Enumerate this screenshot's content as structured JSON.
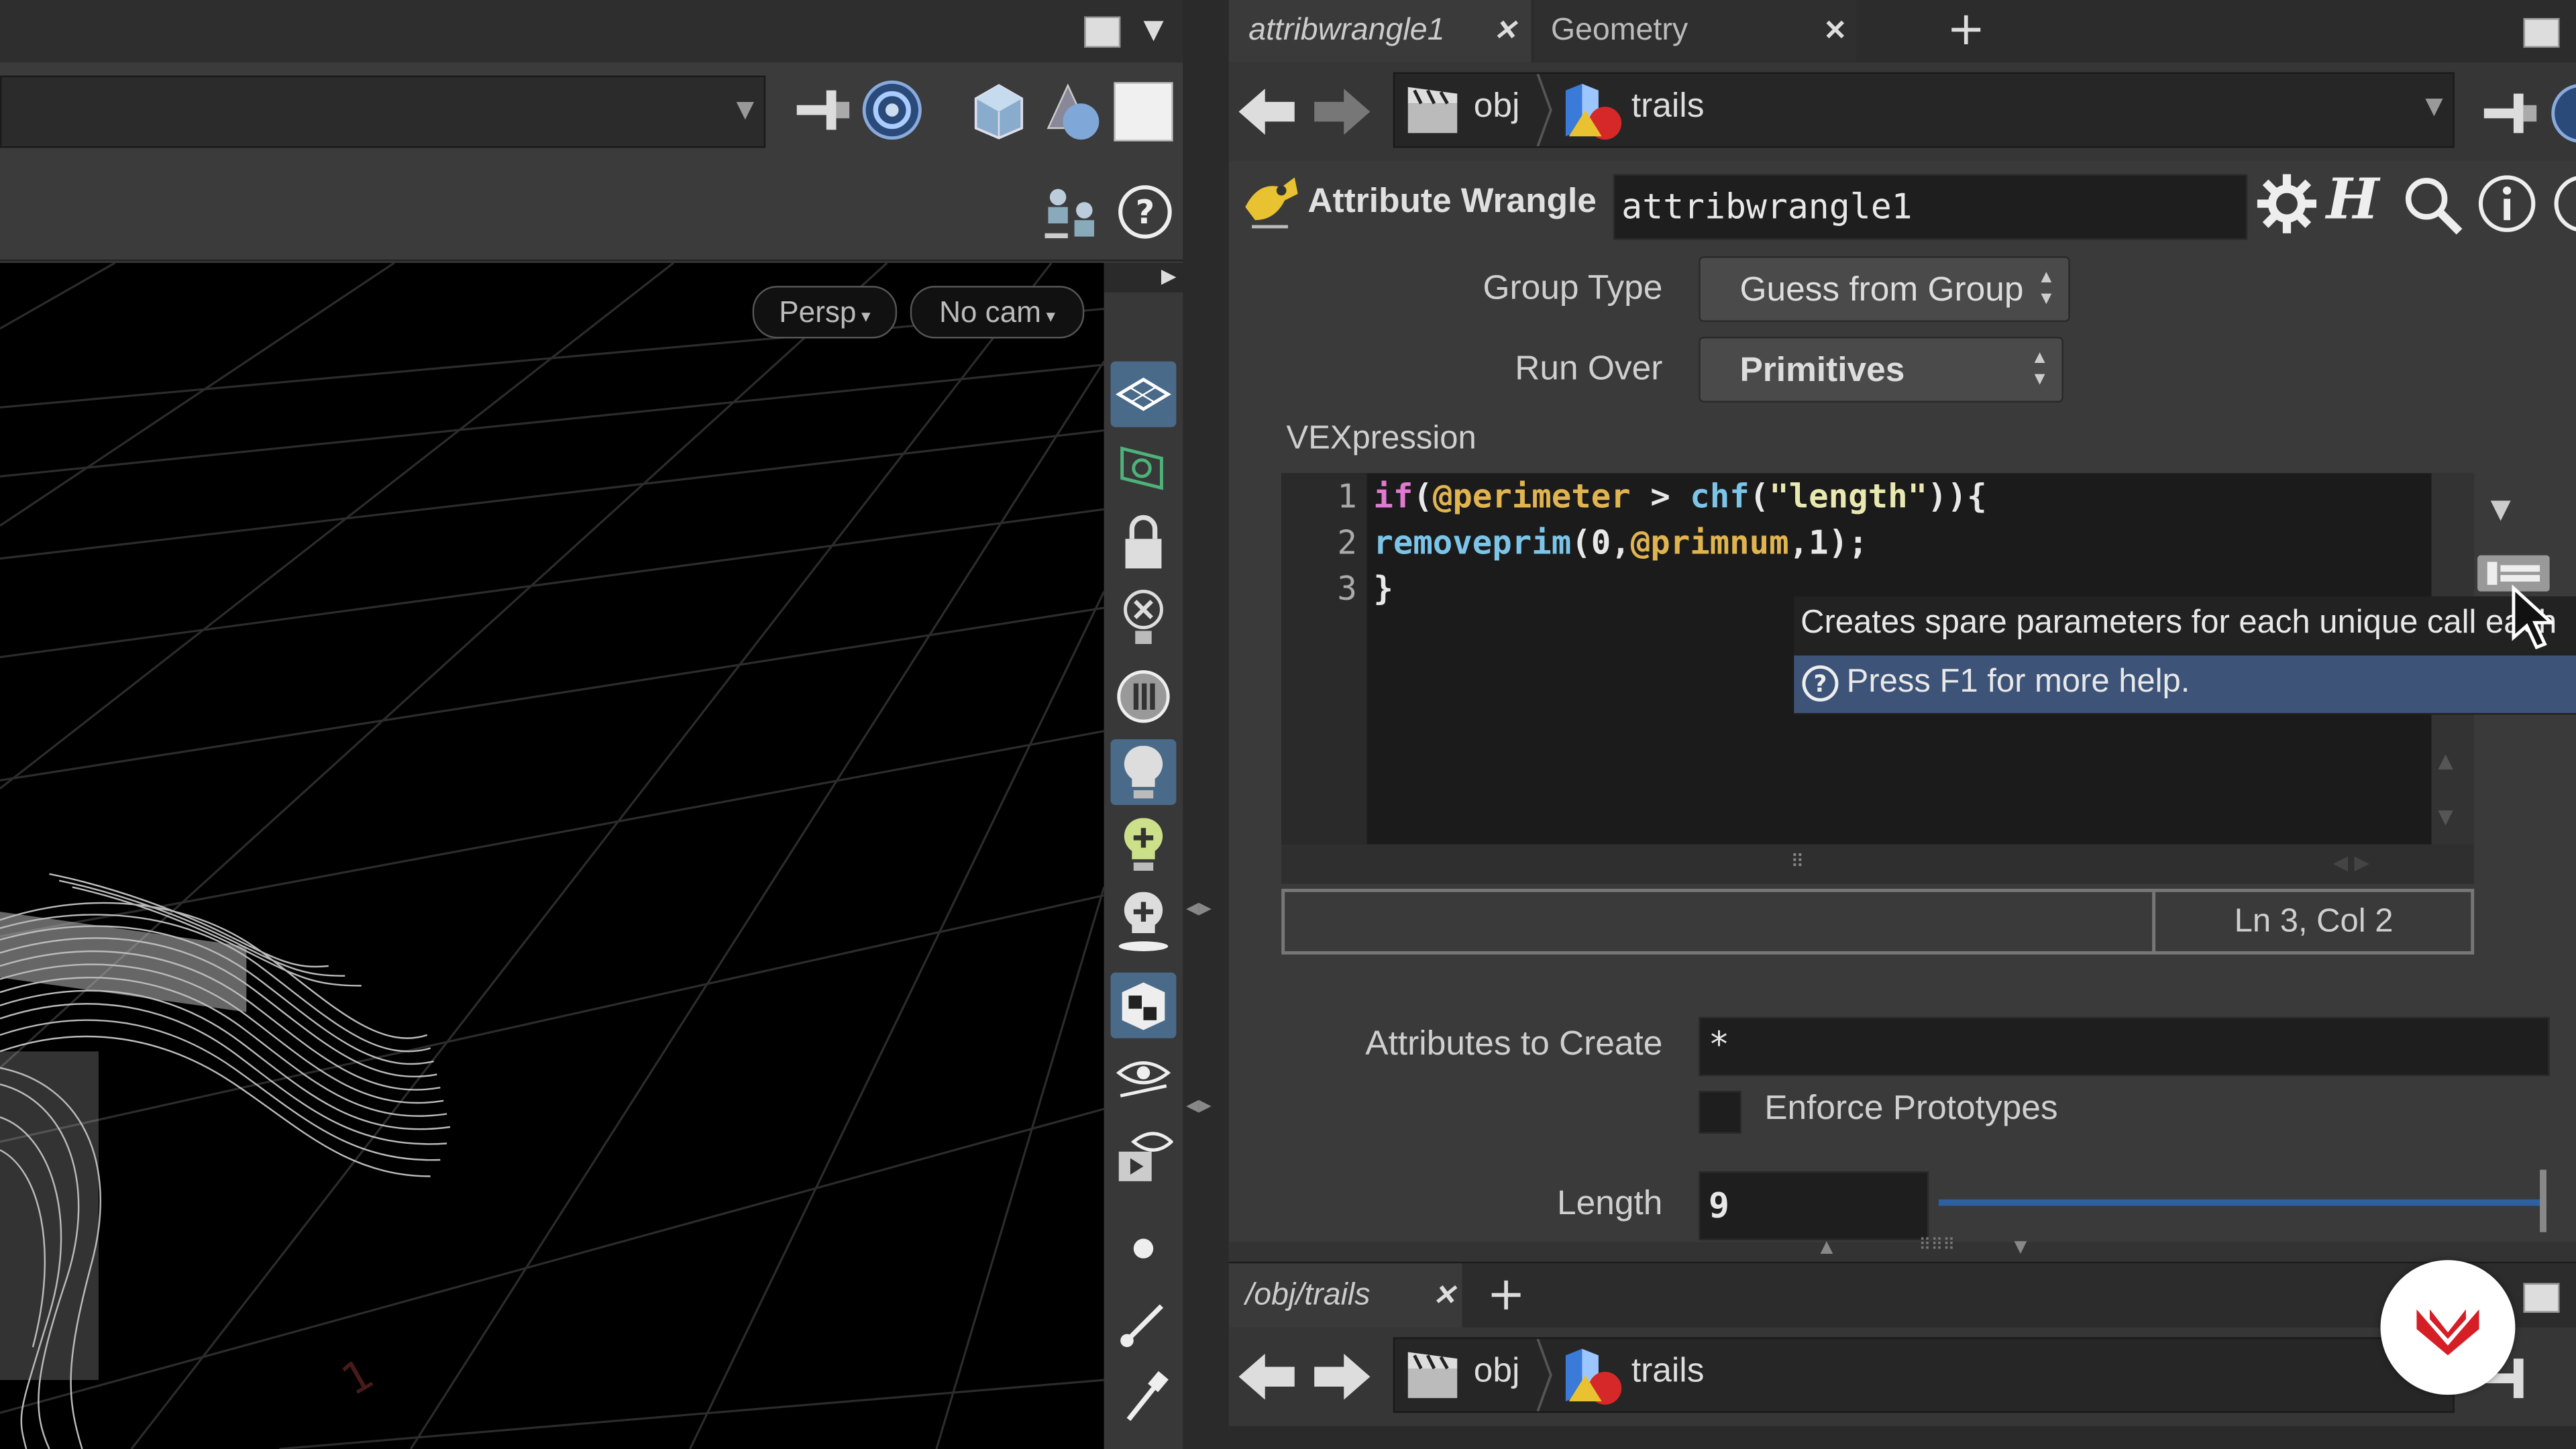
{
  "viewport": {
    "view_menu": "Persp",
    "camera_menu": "No cam"
  },
  "tabs": [
    {
      "label": "attribwrangle1"
    },
    {
      "label": "Geometry Spreadsheet"
    }
  ],
  "path": {
    "network": "obj",
    "node": "trails"
  },
  "node_header": {
    "type_label": "Attribute Wrangle",
    "name_value": "attribwrangle1"
  },
  "params": {
    "group_type_label": "Group Type",
    "group_type_value": "Guess from Group",
    "run_over_label": "Run Over",
    "run_over_value": "Primitives",
    "vexpression_label": "VEXpression",
    "code_lines": [
      {
        "num": "1",
        "tokens": [
          [
            "kw",
            "if"
          ],
          [
            "pr",
            "("
          ],
          [
            "at",
            "@perimeter"
          ],
          [
            "op",
            " > "
          ],
          [
            "fn",
            "chf"
          ],
          [
            "pr",
            "("
          ],
          [
            "str",
            "\"length\""
          ],
          [
            "pr",
            "))"
          ],
          [
            "pr",
            "{"
          ]
        ]
      },
      {
        "num": "2",
        "tokens": [
          [
            "fn",
            "removeprim"
          ],
          [
            "pr",
            "(0,"
          ],
          [
            "at",
            "@primnum"
          ],
          [
            "pr",
            ",1);"
          ]
        ]
      },
      {
        "num": "3",
        "tokens": [
          [
            "pr",
            "}"
          ]
        ]
      }
    ],
    "status_cursor": "Ln 3, Col 2",
    "attributes_label": "Attributes to Create",
    "attributes_value": "*",
    "enforce_label": "Enforce Prototypes",
    "length_label": "Length",
    "length_value": "9",
    "length_slider_fraction": 1.0
  },
  "tooltip": {
    "text": "Creates spare parameters for each unique call each",
    "help": "Press F1 for more help."
  },
  "bottom_pane": {
    "tab_label": "/obj/trails",
    "network": "obj",
    "node": "trails"
  },
  "colors": {
    "accent": "#4a6a8a",
    "tooltip_help_bg": "#3d5478",
    "slider": "#2e5f9e",
    "logo": "#d61e26"
  }
}
